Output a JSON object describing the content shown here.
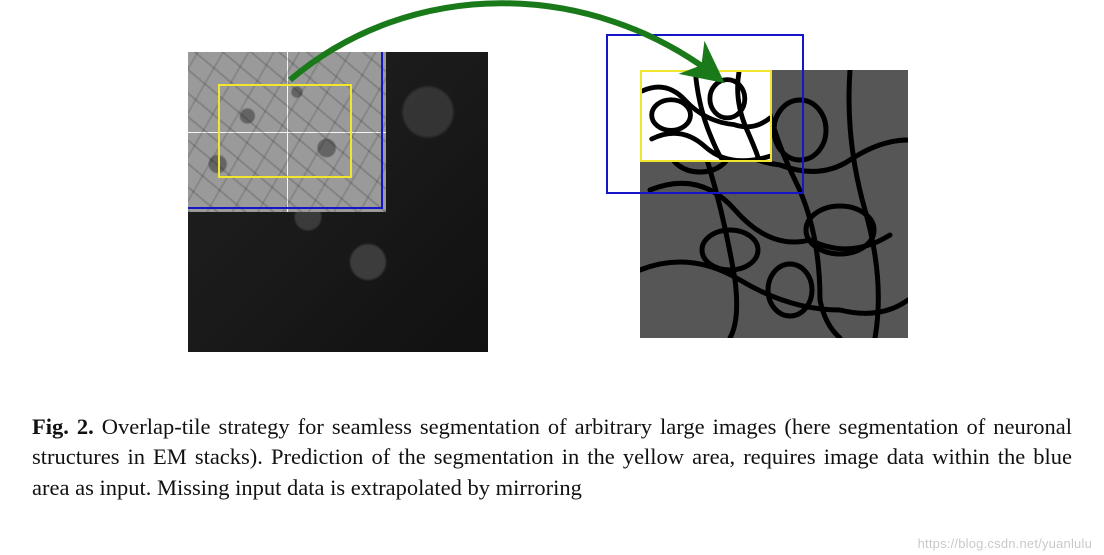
{
  "figure": {
    "label": "Fig. 2.",
    "caption_rest": " Overlap-tile strategy for seamless segmentation of arbitrary large images (here segmentation of neuronal structures in EM stacks). Prediction of the segmentation in the yellow area, requires image data within the blue area as input. Missing input data is extrapolated by mirroring"
  },
  "annotations": {
    "left_image_desc": "input-em-image",
    "right_image_desc": "segmentation-map",
    "yellow_box_desc": "prediction-region",
    "blue_box_desc": "input-context-region",
    "arrow_desc": "maps-to"
  },
  "colors": {
    "blue_box": "#1414c8",
    "yellow_box": "#f2e52d",
    "arrow": "#1a7a1a",
    "seg_bg": "#565656"
  },
  "watermark": "https://blog.csdn.net/yuanlulu"
}
